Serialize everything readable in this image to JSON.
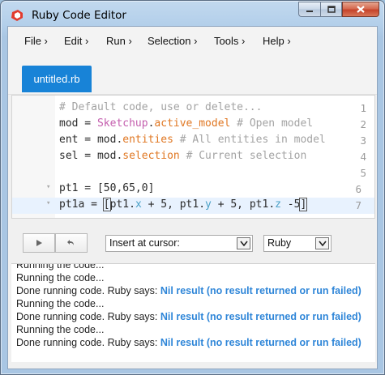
{
  "window": {
    "title": "Ruby Code Editor",
    "icon": "sketchup-icon"
  },
  "menubar": {
    "items": [
      "File ›",
      "Edit ›",
      "Run ›",
      "Selection ›",
      "Tools ›",
      "Help ›"
    ]
  },
  "tabs": [
    {
      "label": "untitled.rb",
      "active": true
    }
  ],
  "editor": {
    "lines": [
      {
        "n": "1",
        "text": "# Default code, use or delete..."
      },
      {
        "n": "2",
        "text": "mod = Sketchup.active_model # Open model"
      },
      {
        "n": "3",
        "text": "ent = mod.entities # All entities in model"
      },
      {
        "n": "4",
        "text": "sel = mod.selection # Current selection"
      },
      {
        "n": "5",
        "text": ""
      },
      {
        "n": "6",
        "text": "pt1 = [50,65,0]",
        "fold": "▾"
      },
      {
        "n": "7",
        "text": "pt1a = [pt1.x + 5, pt1.y + 5, pt1.z -5]",
        "fold": "▾"
      }
    ]
  },
  "controls": {
    "run_icon": "play-icon",
    "undo_icon": "undo-icon",
    "insert_select": "Insert at cursor:",
    "language_select": "Ruby"
  },
  "output": {
    "lines": [
      {
        "text": "Running the code..."
      },
      {
        "text": "Done running code. Ruby says: ",
        "result": "Nil result (no result returned or run failed)"
      },
      {
        "text": "Running the code..."
      },
      {
        "text": "Done running code. Ruby says: ",
        "result": "Nil result (no result returned or run failed)"
      },
      {
        "text": "Running the code..."
      },
      {
        "text": "Done running code. Ruby says: ",
        "result": "Nil result (no result returned or run failed)"
      }
    ],
    "result_color": "#2f86d8"
  },
  "colors": {
    "tab_active": "#1883d7",
    "comment": "#a3a3a3",
    "method": "#e07722",
    "constant": "#c45eae",
    "axis": "#4aa1c7"
  }
}
